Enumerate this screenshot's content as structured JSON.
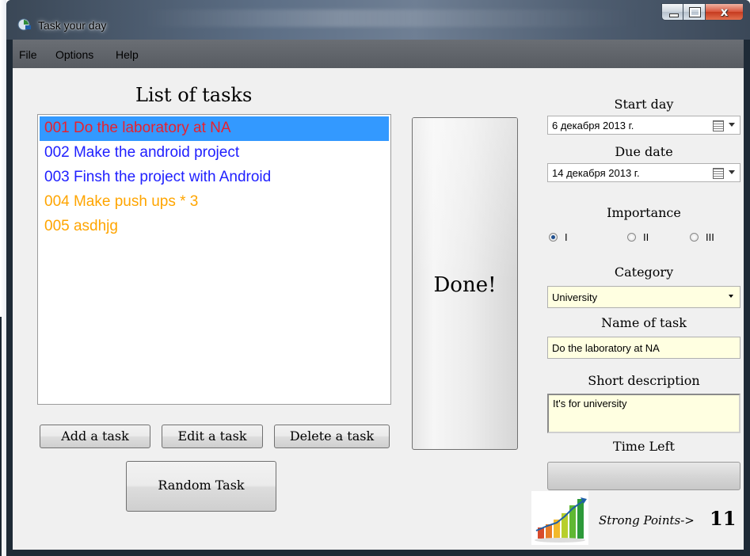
{
  "window": {
    "title": "Task your day",
    "controls": {
      "minimize": "minimize",
      "maximize": "maximize",
      "close": "x"
    }
  },
  "menu": {
    "items": [
      "File",
      "Options",
      "Help"
    ]
  },
  "task_list": {
    "heading": "List of tasks",
    "items": [
      {
        "text": "001 Do the laboratory at NA",
        "color": "#e8212e",
        "selected": true
      },
      {
        "text": "002 Make the android project",
        "color": "#2020ff",
        "selected": false
      },
      {
        "text": "003 Finsh the project with Android",
        "color": "#2020ff",
        "selected": false
      },
      {
        "text": "004 Make push ups * 3",
        "color": "#ffa500",
        "selected": false
      },
      {
        "text": "005 asdhjg",
        "color": "#ffa500",
        "selected": false
      }
    ]
  },
  "buttons": {
    "add": "Add a task",
    "edit": "Edit a task",
    "delete": "Delete a task",
    "random": "Random Task",
    "done": "Done!"
  },
  "details": {
    "start_day_label": "Start day",
    "start_day_value": "6 декабря  2013 г.",
    "due_date_label": "Due date",
    "due_date_value": "14 декабря  2013 г.",
    "importance_label": "Importance",
    "importance_options": [
      "I",
      "II",
      "III"
    ],
    "importance_selected": "I",
    "category_label": "Category",
    "category_value": "University",
    "name_label": "Name of task",
    "name_value": "Do the laboratory at NA",
    "description_label": "Short description",
    "description_value": "It's for university",
    "time_left_label": "Time Left",
    "time_left_fraction": 0
  },
  "points": {
    "label": "Strong Points->",
    "value": "11",
    "icon": "bar-chart-icon"
  },
  "colors": {
    "selection": "#3399ff",
    "input_highlight": "#ffffe1"
  }
}
